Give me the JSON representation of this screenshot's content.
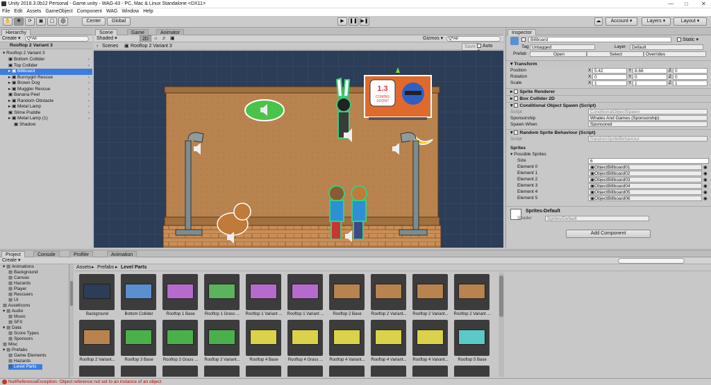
{
  "window": {
    "title": "Unity 2018.3.0b12 Personal - Game.unity - WAG-43 - PC, Mac & Linux Standalone <DX11>"
  },
  "menu": [
    "File",
    "Edit",
    "Assets",
    "GameObject",
    "Component",
    "WAG",
    "Window",
    "Help"
  ],
  "toolbar": {
    "pivot": "Center",
    "space": "Global",
    "account": "Account",
    "layers": "Layers",
    "layout": "Layout"
  },
  "hierarchy": {
    "tab": "Hierarchy",
    "create": "Create",
    "search_placeholder": "Q*All",
    "breadcrumb": "Rooftop 2 Variant 3",
    "root": "Rooftop 2 Variant 3",
    "items": [
      "Bottom Collider",
      "Top Collider",
      "Billboard",
      "Bunnygirl Rescue",
      "Brown Dog",
      "Muggler Rescue",
      "Banana Peel",
      "Random Obstacle",
      "Metal Lamp",
      "Slime Puddle",
      "Metal Lamp (1)",
      "Shadow"
    ],
    "selected": "Billboard"
  },
  "scene": {
    "tabs": [
      "Scene",
      "Game",
      "Animator"
    ],
    "shading": "Shaded",
    "mode2d": "2D",
    "gizmos": "Gizmos",
    "search_placeholder": "Q*All",
    "breadcrumb_scenes": "Scenes",
    "breadcrumb_prefab": "Rooftop 2 Variant 3",
    "save": "Save",
    "autosave": "Auto Save",
    "billboard_text": "1.3 COMING SOON?"
  },
  "inspector": {
    "tab": "Inspector",
    "object_name": "Billboard",
    "static": "Static",
    "tag_label": "Tag",
    "tag": "Untagged",
    "layer_label": "Layer",
    "layer": "Default",
    "prefab_label": "Prefab",
    "prefab_open": "Open",
    "prefab_select": "Select",
    "prefab_overrides": "Overrides",
    "transform": {
      "title": "Transform",
      "position_label": "Position",
      "position": [
        "5.42",
        "8.66",
        "0"
      ],
      "rotation_label": "Rotation",
      "rotation": [
        "0",
        "0",
        "0"
      ],
      "scale_label": "Scale",
      "scale": [
        "1",
        "1",
        "1"
      ]
    },
    "sprite_renderer": "Sprite Renderer",
    "box_collider": "Box Collider 2D",
    "cos": {
      "title": "Conditional Object Spawn (Script)",
      "script_label": "Script",
      "script": "ConditionalObjectSpawn",
      "sponsorship_label": "Sponsorship",
      "sponsorship": "Whales And Games (Sponsorship)",
      "spawn_label": "Spawn When",
      "spawn": "Sponsored"
    },
    "rsb": {
      "title": "Random Sprite Behaviour (Script)",
      "script_label": "Script",
      "script": "RandomSpriteBehaviour",
      "sprites_label": "Sprites",
      "possible_label": "Possible Sprites",
      "size_label": "Size",
      "size": "6",
      "elements": [
        {
          "label": "Element 0",
          "value": "ObjectBillboard01"
        },
        {
          "label": "Element 1",
          "value": "ObjectBillboard02"
        },
        {
          "label": "Element 2",
          "value": "ObjectBillboard03"
        },
        {
          "label": "Element 3",
          "value": "ObjectBillboard04"
        },
        {
          "label": "Element 4",
          "value": "ObjectBillboard05"
        },
        {
          "label": "Element 5",
          "value": "ObjectBillboard06"
        }
      ]
    },
    "material": "Sprites-Default",
    "shader_label": "Shader",
    "shader": "Sprites/Default",
    "add_component": "Add Component"
  },
  "project": {
    "tabs": [
      "Project",
      "Console",
      "Profiler",
      "Animation"
    ],
    "create": "Create",
    "tree_top": "Animations",
    "tree": [
      "Animations",
      "Background",
      "Canvas",
      "Hazards",
      "Player",
      "Rescuers",
      "UI",
      "AssetIcons",
      "Audio",
      "Music",
      "SFX",
      "Data",
      "Score Types",
      "Sponsors",
      "Misc",
      "Prefabs",
      "Game Elements",
      "Hazards",
      "Level Parts"
    ],
    "breadcrumb": [
      "Assets",
      "Prefabs",
      "Level Parts"
    ],
    "assets_row1": [
      "Background",
      "Bottom Collider",
      "Rooftop 1 Base",
      "Rooftop 1 Grass ...",
      "Rooftop 1 Variant ...",
      "Rooftop 1 Variant ...",
      "Rooftop 2 Base",
      "Rooftop 2 Variant...",
      "Rooftop 2 Variant...",
      "Rooftop 2 Variant ..."
    ],
    "assets_row2": [
      "Rooftop 2 Variant...",
      "Rooftop 3 Base",
      "Rooftop 3 Grass ...",
      "Rooftop 3 Variant...",
      "Rooftop 4 Base",
      "Rooftop 4 Grass ...",
      "Rooftop 4 Variant...",
      "Rooftop 4 Variant...",
      "Rooftop 4 Variant...",
      "Rooftop 5 Base"
    ]
  },
  "status": {
    "error": "NullReferenceException: Object reference not set to an instance of an object"
  },
  "colors": {
    "scene_bg": "#2b3d57",
    "selection": "#3b7ee0",
    "roof": "#b8834e",
    "error": "#c0392b"
  }
}
